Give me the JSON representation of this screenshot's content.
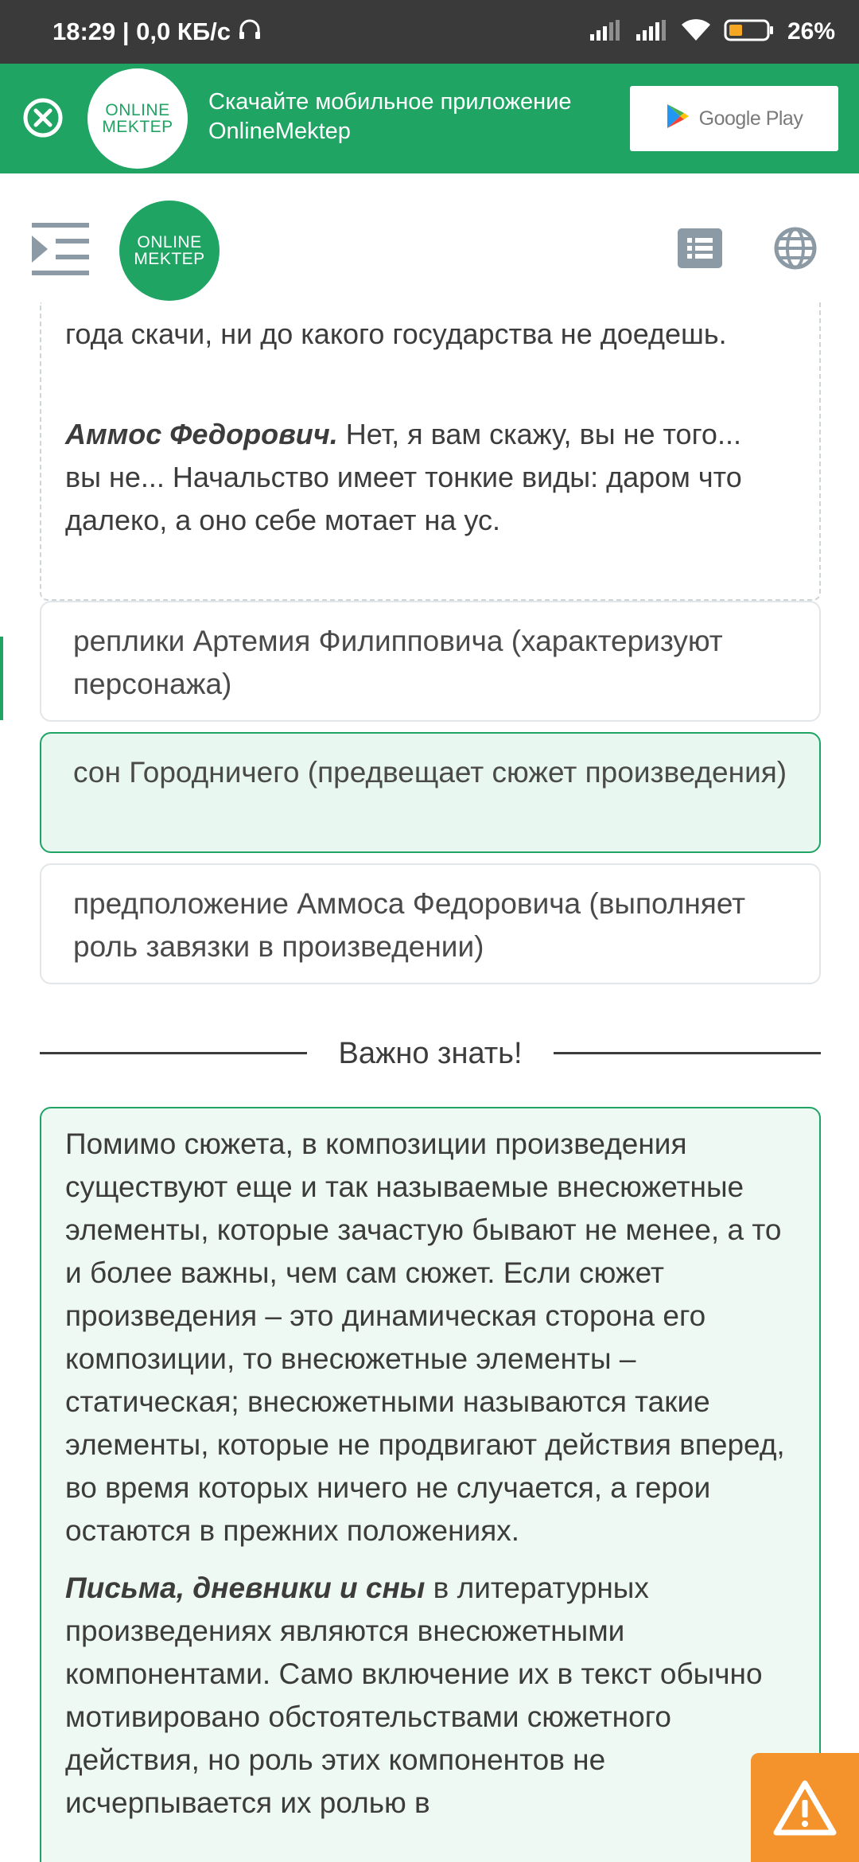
{
  "status_bar": {
    "time_speed": "18:29 | 0,0 КБ/с",
    "battery_percent": "26%"
  },
  "banner": {
    "logo_line1": "ONLINE",
    "logo_line2": "MEKTEP",
    "text": "Скачайте мобильное приложение OnlineMektep",
    "store_button": "Google Play",
    "accent_color": "#1fa463"
  },
  "nav": {
    "logo_line1": "ONLINE",
    "logo_line2": "MEKTEP"
  },
  "quote": {
    "fragment_top": "года скачи, ни до какого государства не доедешь.",
    "speaker": "Аммос Федорович.",
    "speech": " Нет, я вам скажу, вы не того... вы не... Начальство имеет тонкие виды: даром что далеко, а оно себе мотает на ус."
  },
  "options": [
    {
      "text": "реплики Артемия Филипповича (характеризуют персонажа)"
    },
    {
      "text": "сон Городничего (предвещает сюжет произведения)"
    },
    {
      "text": "предположение Аммоса Федоровича (выполняет роль завязки в произведении)"
    }
  ],
  "section": {
    "title": "Важно знать!"
  },
  "info": {
    "paragraph1": "Помимо сюжета, в композиции произведения существуют еще и так называемые внесюжетные элементы, которые зачастую бывают не менее, а то и более важны, чем сам сюжет. Если сюжет произведения – это динамическая сторона его композиции, то внесюжетные элементы – статическая; внесюжетными называются такие элементы, которые не продвигают действия вперед, во время которых ничего не случается, а герои остаются в прежних положениях.",
    "paragraph2_bold": "Письма, дневники и сны",
    "paragraph2_rest": " в литературных произведениях являются внесюжетными компонентами. Само включение их в текст обычно мотивировано обстоятельствами сюжетного действия, но роль этих компонентов не исчерпывается их ролью в"
  },
  "icons": {
    "close": "close-circle-icon",
    "store": "google-play-icon",
    "menu": "menu-indent-icon",
    "list": "list-icon",
    "language": "globe-icon",
    "report": "warning-icon"
  }
}
